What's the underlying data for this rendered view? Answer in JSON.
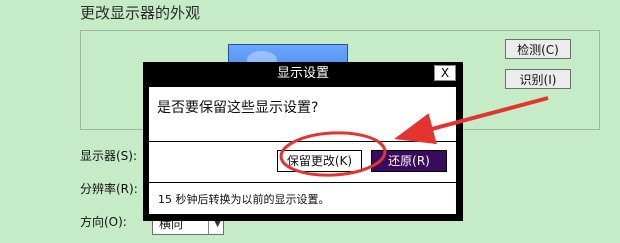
{
  "page": {
    "title": "更改显示器的外观",
    "detect_label": "检测(C)",
    "identify_label": "识别(I)",
    "display_label": "显示器(S):",
    "resolution_label": "分辨率(R):",
    "orientation_label": "方向(O):",
    "orientation_value": "横向"
  },
  "dialog": {
    "title": "显示设置",
    "close_glyph": "X",
    "question": "是否要保留这些显示设置?",
    "keep_label": "保留更改(K)",
    "revert_label": "还原(R)",
    "countdown": "15 秒钟后转换为以前的显示设置。"
  },
  "colors": {
    "background": "#c6ebc7",
    "dialog_frame": "#000000",
    "revert_button": "#3a0a5e",
    "annotation": "#e3342f"
  }
}
